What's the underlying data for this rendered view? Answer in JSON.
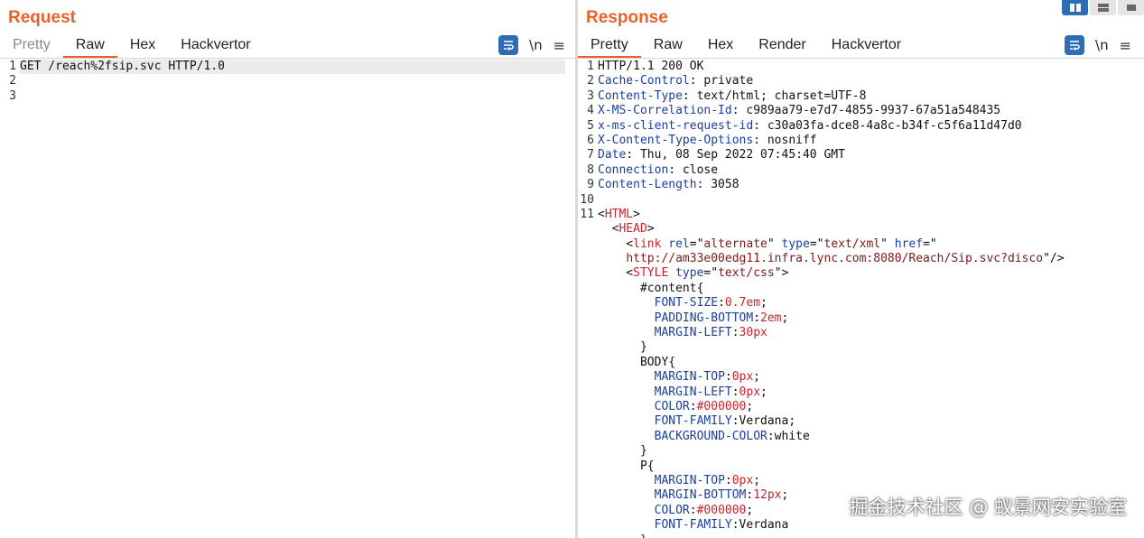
{
  "request": {
    "title": "Request",
    "tabs": [
      "Pretty",
      "Raw",
      "Hex",
      "Hackvertor"
    ],
    "newline_label": "\\n",
    "menu_label": "≡",
    "lines": [
      {
        "n": "1",
        "highlight": true,
        "segs": [
          {
            "t": "GET /reach%2fsip.svc HTTP/1.0",
            "c": "plain"
          }
        ]
      },
      {
        "n": "2",
        "segs": []
      },
      {
        "n": "3",
        "segs": []
      }
    ]
  },
  "response": {
    "title": "Response",
    "tabs": [
      "Pretty",
      "Raw",
      "Hex",
      "Render",
      "Hackvertor"
    ],
    "newline_label": "\\n",
    "menu_label": "≡",
    "lines": [
      {
        "n": "1",
        "segs": [
          {
            "t": "HTTP/1.1 200 OK",
            "c": "plain"
          }
        ]
      },
      {
        "n": "2",
        "segs": [
          {
            "t": "Cache-Control",
            "c": "hname"
          },
          {
            "t": ": private",
            "c": "plain"
          }
        ]
      },
      {
        "n": "3",
        "segs": [
          {
            "t": "Content-Type",
            "c": "hname"
          },
          {
            "t": ": text/html; charset=UTF-8",
            "c": "plain"
          }
        ]
      },
      {
        "n": "4",
        "segs": [
          {
            "t": "X-MS-Correlation-Id",
            "c": "hname"
          },
          {
            "t": ": c989aa79-e7d7-4855-9937-67a51a548435",
            "c": "plain"
          }
        ]
      },
      {
        "n": "5",
        "segs": [
          {
            "t": "x-ms-client-request-id",
            "c": "hname"
          },
          {
            "t": ": c30a03fa-dce8-4a8c-b34f-c5f6a11d47d0",
            "c": "plain"
          }
        ]
      },
      {
        "n": "6",
        "segs": [
          {
            "t": "X-Content-Type-Options",
            "c": "hname"
          },
          {
            "t": ": nosniff",
            "c": "plain"
          }
        ]
      },
      {
        "n": "7",
        "segs": [
          {
            "t": "Date",
            "c": "hname"
          },
          {
            "t": ": Thu, 08 Sep 2022 07:45:40 GMT",
            "c": "plain"
          }
        ]
      },
      {
        "n": "8",
        "segs": [
          {
            "t": "Connection",
            "c": "hname"
          },
          {
            "t": ": close",
            "c": "plain"
          }
        ]
      },
      {
        "n": "9",
        "segs": [
          {
            "t": "Content-Length",
            "c": "hname"
          },
          {
            "t": ": 3058",
            "c": "plain"
          }
        ]
      },
      {
        "n": "10",
        "segs": []
      },
      {
        "n": "11",
        "segs": [
          {
            "t": "<",
            "c": "plain"
          },
          {
            "t": "HTML",
            "c": "tag"
          },
          {
            "t": ">",
            "c": "plain"
          }
        ]
      },
      {
        "n": "",
        "segs": [
          {
            "t": "  <",
            "c": "plain"
          },
          {
            "t": "HEAD",
            "c": "tag"
          },
          {
            "t": ">",
            "c": "plain"
          }
        ]
      },
      {
        "n": "",
        "segs": [
          {
            "t": "    <",
            "c": "plain"
          },
          {
            "t": "link",
            "c": "tag"
          },
          {
            "t": " ",
            "c": "plain"
          },
          {
            "t": "rel",
            "c": "attr"
          },
          {
            "t": "=\"",
            "c": "plain"
          },
          {
            "t": "alternate",
            "c": "str"
          },
          {
            "t": "\" ",
            "c": "plain"
          },
          {
            "t": "type",
            "c": "attr"
          },
          {
            "t": "=\"",
            "c": "plain"
          },
          {
            "t": "text/xml",
            "c": "str"
          },
          {
            "t": "\" ",
            "c": "plain"
          },
          {
            "t": "href",
            "c": "attr"
          },
          {
            "t": "=\"",
            "c": "plain"
          }
        ]
      },
      {
        "n": "",
        "segs": [
          {
            "t": "    ",
            "c": "plain"
          },
          {
            "t": "http://am33e00edg11.infra.lync.com:8080/Reach/Sip.svc?disco",
            "c": "str"
          },
          {
            "t": "\"/>",
            "c": "plain"
          }
        ]
      },
      {
        "n": "",
        "segs": [
          {
            "t": "    <",
            "c": "plain"
          },
          {
            "t": "STYLE",
            "c": "tag"
          },
          {
            "t": " ",
            "c": "plain"
          },
          {
            "t": "type",
            "c": "attr"
          },
          {
            "t": "=\"",
            "c": "plain"
          },
          {
            "t": "text/css",
            "c": "str"
          },
          {
            "t": "\">",
            "c": "plain"
          }
        ]
      },
      {
        "n": "",
        "segs": [
          {
            "t": "      #content{",
            "c": "plain"
          }
        ]
      },
      {
        "n": "",
        "segs": [
          {
            "t": "        ",
            "c": "plain"
          },
          {
            "t": "FONT-SIZE",
            "c": "prop"
          },
          {
            "t": ":",
            "c": "plain"
          },
          {
            "t": "0.7em",
            "c": "val"
          },
          {
            "t": ";",
            "c": "plain"
          }
        ]
      },
      {
        "n": "",
        "segs": [
          {
            "t": "        ",
            "c": "plain"
          },
          {
            "t": "PADDING-BOTTOM",
            "c": "prop"
          },
          {
            "t": ":",
            "c": "plain"
          },
          {
            "t": "2em",
            "c": "val"
          },
          {
            "t": ";",
            "c": "plain"
          }
        ]
      },
      {
        "n": "",
        "segs": [
          {
            "t": "        ",
            "c": "plain"
          },
          {
            "t": "MARGIN-LEFT",
            "c": "prop"
          },
          {
            "t": ":",
            "c": "plain"
          },
          {
            "t": "30px",
            "c": "val"
          }
        ]
      },
      {
        "n": "",
        "segs": [
          {
            "t": "      }",
            "c": "plain"
          }
        ]
      },
      {
        "n": "",
        "segs": [
          {
            "t": "      BODY{",
            "c": "plain"
          }
        ]
      },
      {
        "n": "",
        "segs": [
          {
            "t": "        ",
            "c": "plain"
          },
          {
            "t": "MARGIN-TOP",
            "c": "prop"
          },
          {
            "t": ":",
            "c": "plain"
          },
          {
            "t": "0px",
            "c": "val"
          },
          {
            "t": ";",
            "c": "plain"
          }
        ]
      },
      {
        "n": "",
        "segs": [
          {
            "t": "        ",
            "c": "plain"
          },
          {
            "t": "MARGIN-LEFT",
            "c": "prop"
          },
          {
            "t": ":",
            "c": "plain"
          },
          {
            "t": "0px",
            "c": "val"
          },
          {
            "t": ";",
            "c": "plain"
          }
        ]
      },
      {
        "n": "",
        "segs": [
          {
            "t": "        ",
            "c": "plain"
          },
          {
            "t": "COLOR",
            "c": "prop"
          },
          {
            "t": ":",
            "c": "plain"
          },
          {
            "t": "#000000",
            "c": "val"
          },
          {
            "t": ";",
            "c": "plain"
          }
        ]
      },
      {
        "n": "",
        "segs": [
          {
            "t": "        ",
            "c": "plain"
          },
          {
            "t": "FONT-FAMILY",
            "c": "prop"
          },
          {
            "t": ":Verdana;",
            "c": "plain"
          }
        ]
      },
      {
        "n": "",
        "segs": [
          {
            "t": "        ",
            "c": "plain"
          },
          {
            "t": "BACKGROUND-COLOR",
            "c": "prop"
          },
          {
            "t": ":white",
            "c": "plain"
          }
        ]
      },
      {
        "n": "",
        "segs": [
          {
            "t": "      }",
            "c": "plain"
          }
        ]
      },
      {
        "n": "",
        "segs": [
          {
            "t": "      P{",
            "c": "plain"
          }
        ]
      },
      {
        "n": "",
        "segs": [
          {
            "t": "        ",
            "c": "plain"
          },
          {
            "t": "MARGIN-TOP",
            "c": "prop"
          },
          {
            "t": ":",
            "c": "plain"
          },
          {
            "t": "0px",
            "c": "val"
          },
          {
            "t": ";",
            "c": "plain"
          }
        ]
      },
      {
        "n": "",
        "segs": [
          {
            "t": "        ",
            "c": "plain"
          },
          {
            "t": "MARGIN-BOTTOM",
            "c": "prop"
          },
          {
            "t": ":",
            "c": "plain"
          },
          {
            "t": "12px",
            "c": "val"
          },
          {
            "t": ";",
            "c": "plain"
          }
        ]
      },
      {
        "n": "",
        "segs": [
          {
            "t": "        ",
            "c": "plain"
          },
          {
            "t": "COLOR",
            "c": "prop"
          },
          {
            "t": ":",
            "c": "plain"
          },
          {
            "t": "#000000",
            "c": "val"
          },
          {
            "t": ";",
            "c": "plain"
          }
        ]
      },
      {
        "n": "",
        "segs": [
          {
            "t": "        ",
            "c": "plain"
          },
          {
            "t": "FONT-FAMILY",
            "c": "prop"
          },
          {
            "t": ":Verdana",
            "c": "plain"
          }
        ]
      },
      {
        "n": "",
        "segs": [
          {
            "t": "      }",
            "c": "plain"
          }
        ]
      }
    ]
  },
  "watermark": "掘金技术社区 @ 蚁景网安实验室",
  "colors": {
    "accent": "#e8612c",
    "tool_blue": "#2e6db3"
  }
}
